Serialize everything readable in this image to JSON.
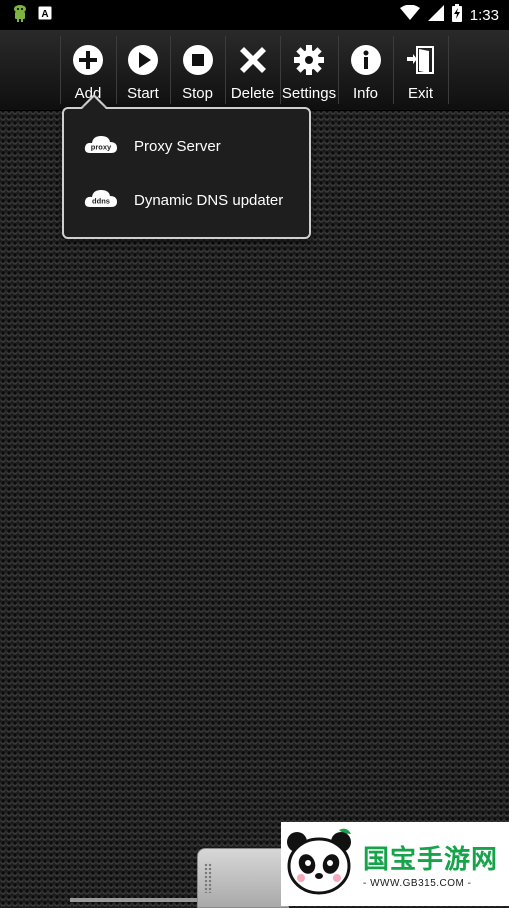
{
  "status_bar": {
    "time": "1:33",
    "icons": [
      "android-debug-icon",
      "keyboard-a-icon",
      "wifi-icon",
      "signal-icon",
      "battery-charging-icon"
    ]
  },
  "toolbar": {
    "buttons": [
      {
        "label": "Add",
        "icon": "plus-circle-icon"
      },
      {
        "label": "Start",
        "icon": "play-circle-icon"
      },
      {
        "label": "Stop",
        "icon": "stop-circle-icon"
      },
      {
        "label": "Delete",
        "icon": "x-icon"
      },
      {
        "label": "Settings",
        "icon": "gear-icon"
      },
      {
        "label": "Info",
        "icon": "info-circle-icon"
      },
      {
        "label": "Exit",
        "icon": "exit-door-icon"
      }
    ]
  },
  "add_menu": {
    "items": [
      {
        "label": "Proxy Server",
        "icon": "proxy-cloud-icon",
        "icon_text": "proxy"
      },
      {
        "label": "Dynamic DNS updater",
        "icon": "ddns-cloud-icon",
        "icon_text": "ddns"
      }
    ]
  },
  "watermark": {
    "brand": "国宝手游网",
    "site": "- WWW.GB315.COM -"
  }
}
